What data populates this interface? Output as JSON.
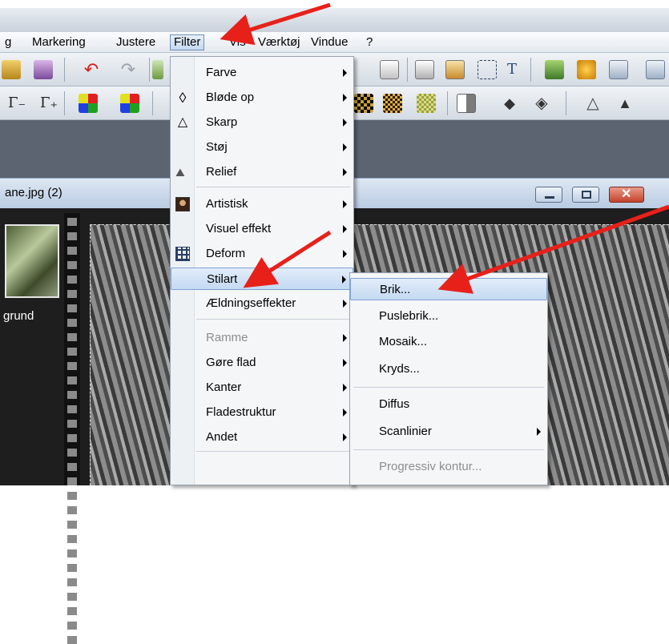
{
  "menubar": {
    "items": [
      "g",
      "Markering",
      "Justere",
      "Filter",
      "Vis",
      "Værktøj",
      "Vindue",
      "?"
    ],
    "open_index": 3
  },
  "toolbar": {
    "gamma_minus": "Γ₋",
    "gamma_plus": "Γ₊",
    "text_tool": "T"
  },
  "document": {
    "title": "ane.jpg (2)",
    "layer_label": "grund"
  },
  "filter_menu": {
    "items": [
      {
        "label": "Farve",
        "submenu": true,
        "disabled": false,
        "icon": null
      },
      {
        "label": "Bløde op",
        "submenu": true,
        "disabled": false,
        "icon": "drop-outline-icon"
      },
      {
        "label": "Skarp",
        "submenu": true,
        "disabled": false,
        "icon": "triangle-outline-icon"
      },
      {
        "label": "Støj",
        "submenu": true,
        "disabled": false,
        "icon": null
      },
      {
        "label": "Relief",
        "submenu": true,
        "disabled": false,
        "icon": "relief-icon"
      },
      {
        "label": "Artistisk",
        "submenu": true,
        "disabled": false,
        "icon": "portrait-icon"
      },
      {
        "label": "Visuel effekt",
        "submenu": true,
        "disabled": false,
        "icon": null
      },
      {
        "label": "Deform",
        "submenu": true,
        "disabled": false,
        "icon": "grid-deform-icon"
      },
      {
        "label": "Stilart",
        "submenu": true,
        "disabled": false,
        "icon": null,
        "highlighted": true
      },
      {
        "label": "Ældningseffekter",
        "submenu": true,
        "disabled": false,
        "icon": null
      },
      {
        "label": "Ramme",
        "submenu": true,
        "disabled": true,
        "icon": null
      },
      {
        "label": "Gøre flad",
        "submenu": true,
        "disabled": false,
        "icon": null
      },
      {
        "label": "Kanter",
        "submenu": true,
        "disabled": false,
        "icon": null
      },
      {
        "label": "Fladestruktur",
        "submenu": true,
        "disabled": false,
        "icon": null
      },
      {
        "label": "Andet",
        "submenu": true,
        "disabled": false,
        "icon": null
      }
    ]
  },
  "stilart_submenu": {
    "items": [
      {
        "label": "Brik...",
        "submenu": false,
        "disabled": false,
        "highlighted": true
      },
      {
        "label": "Puslebrik...",
        "submenu": false,
        "disabled": false
      },
      {
        "label": "Mosaik...",
        "submenu": false,
        "disabled": false
      },
      {
        "label": "Kryds...",
        "submenu": false,
        "disabled": false
      },
      {
        "label": "Diffus",
        "submenu": false,
        "disabled": false
      },
      {
        "label": "Scanlinier",
        "submenu": true,
        "disabled": false
      },
      {
        "label": "Progressiv kontur...",
        "submenu": false,
        "disabled": true
      }
    ]
  },
  "colors": {
    "annotation_arrow": "#e8201a",
    "menu_highlight": "#c4d9f2",
    "disabled_text": "#8d8d8d"
  }
}
